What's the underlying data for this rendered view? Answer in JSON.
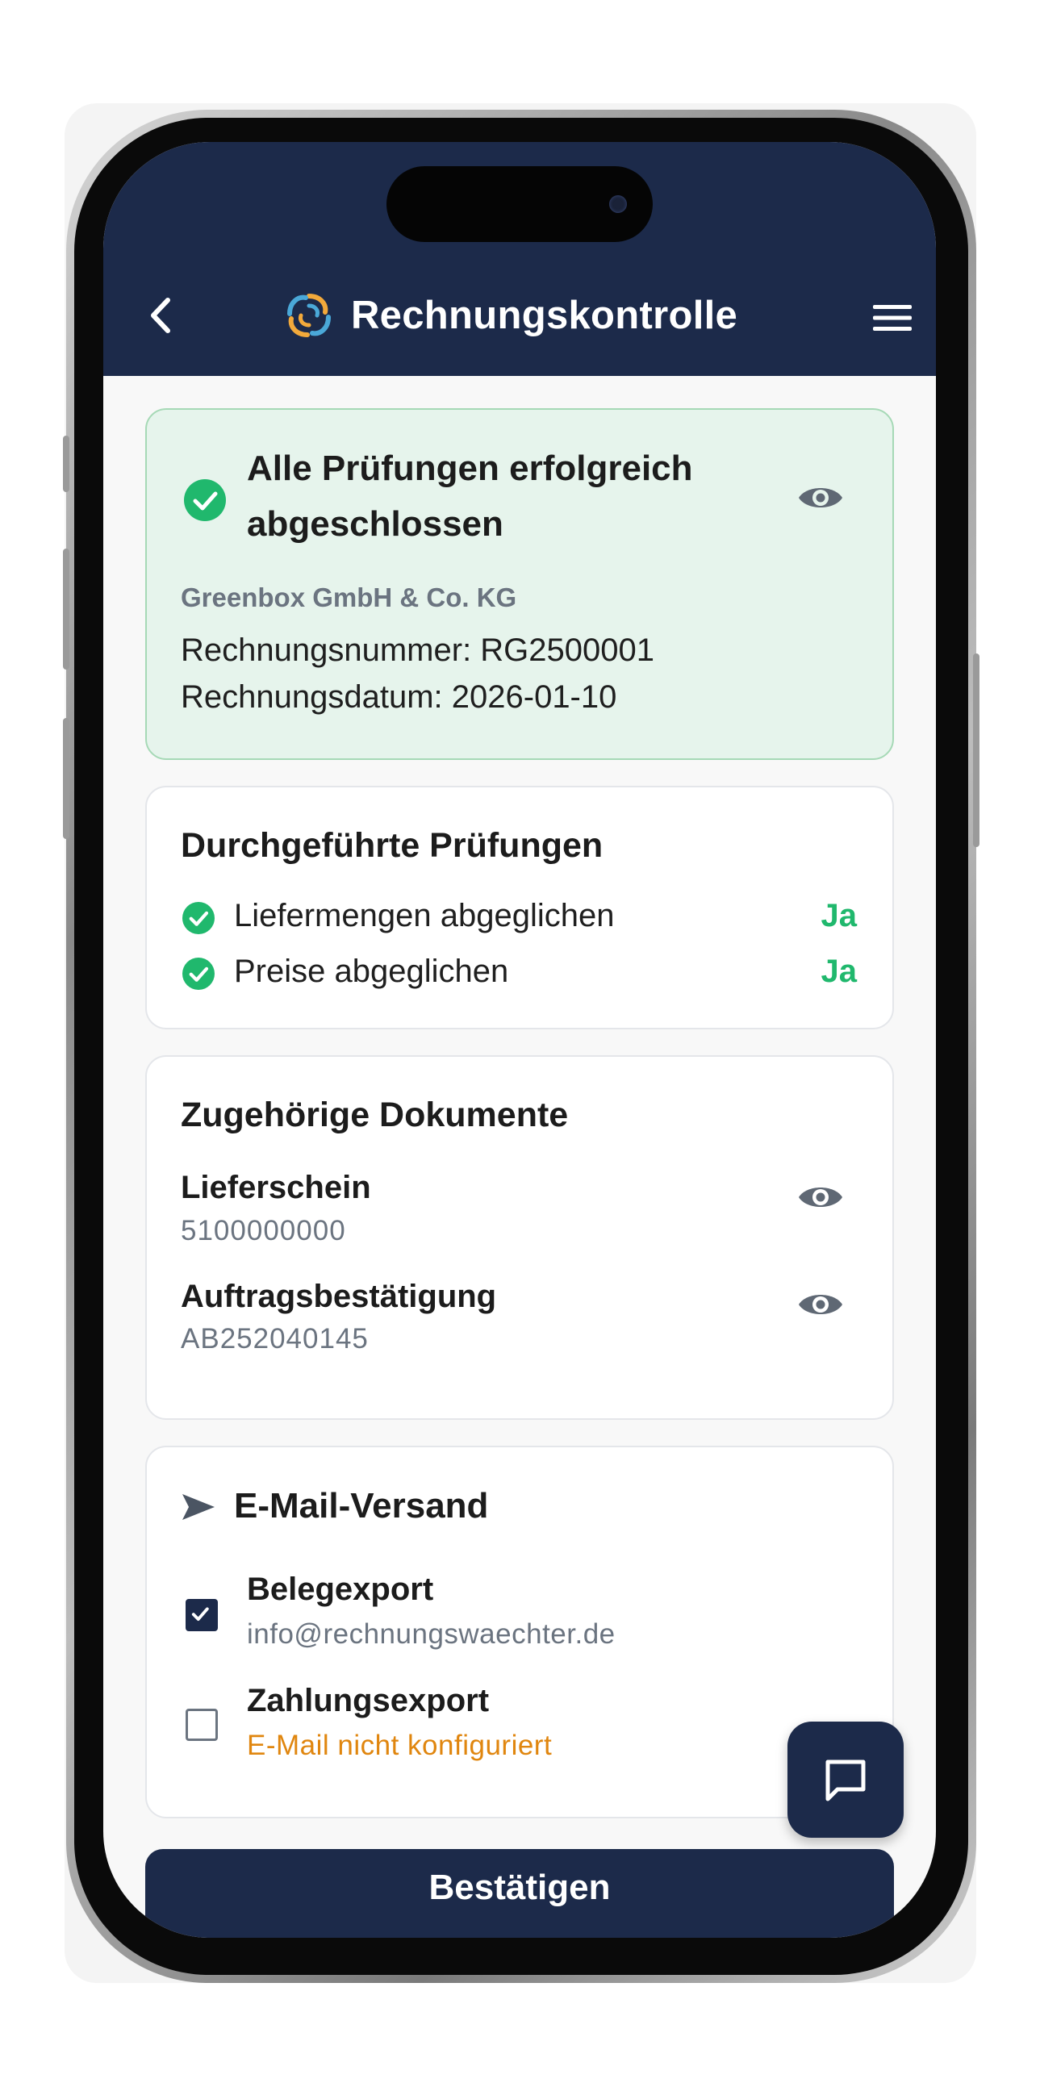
{
  "header": {
    "title": "Rechnungskontrolle",
    "background_color": "#1c2a4a",
    "back_icon": "chevron-left-icon",
    "menu_icon": "hamburger-menu-icon",
    "logo_icon": "swirl-logo-icon"
  },
  "status_card": {
    "title_line1": "Alle Prüfungen erfolgreich",
    "title_line2": "abgeschlossen",
    "supplier": "Greenbox GmbH & Co. KG",
    "invoice_number_label": "Rechnungsnummer: RG2500001",
    "invoice_date_label": "Rechnungsdatum: 2026-01-10",
    "status_color": "#20b86d"
  },
  "checks_card": {
    "title": "Durchgeführte Prüfungen",
    "items": [
      {
        "label": "Liefermengen abgeglichen",
        "value": "Ja"
      },
      {
        "label": "Preise abgeglichen",
        "value": "Ja"
      }
    ]
  },
  "documents_card": {
    "title": "Zugehörige Dokumente",
    "items": [
      {
        "name": "Lieferschein",
        "number": "5100000000"
      },
      {
        "name": "Auftragsbestätigung",
        "number": "AB252040145"
      }
    ]
  },
  "email_card": {
    "title": "E-Mail-Versand",
    "items": [
      {
        "label": "Belegexport",
        "sub": "info@rechnungswaechter.de",
        "checked": true
      },
      {
        "label": "Zahlungsexport",
        "sub": "E-Mail nicht konfiguriert",
        "checked": false,
        "warning_color": "#e0860f"
      }
    ]
  },
  "actions": {
    "confirm_label": "Bestätigen",
    "chat_icon": "chat-bubble-icon"
  }
}
